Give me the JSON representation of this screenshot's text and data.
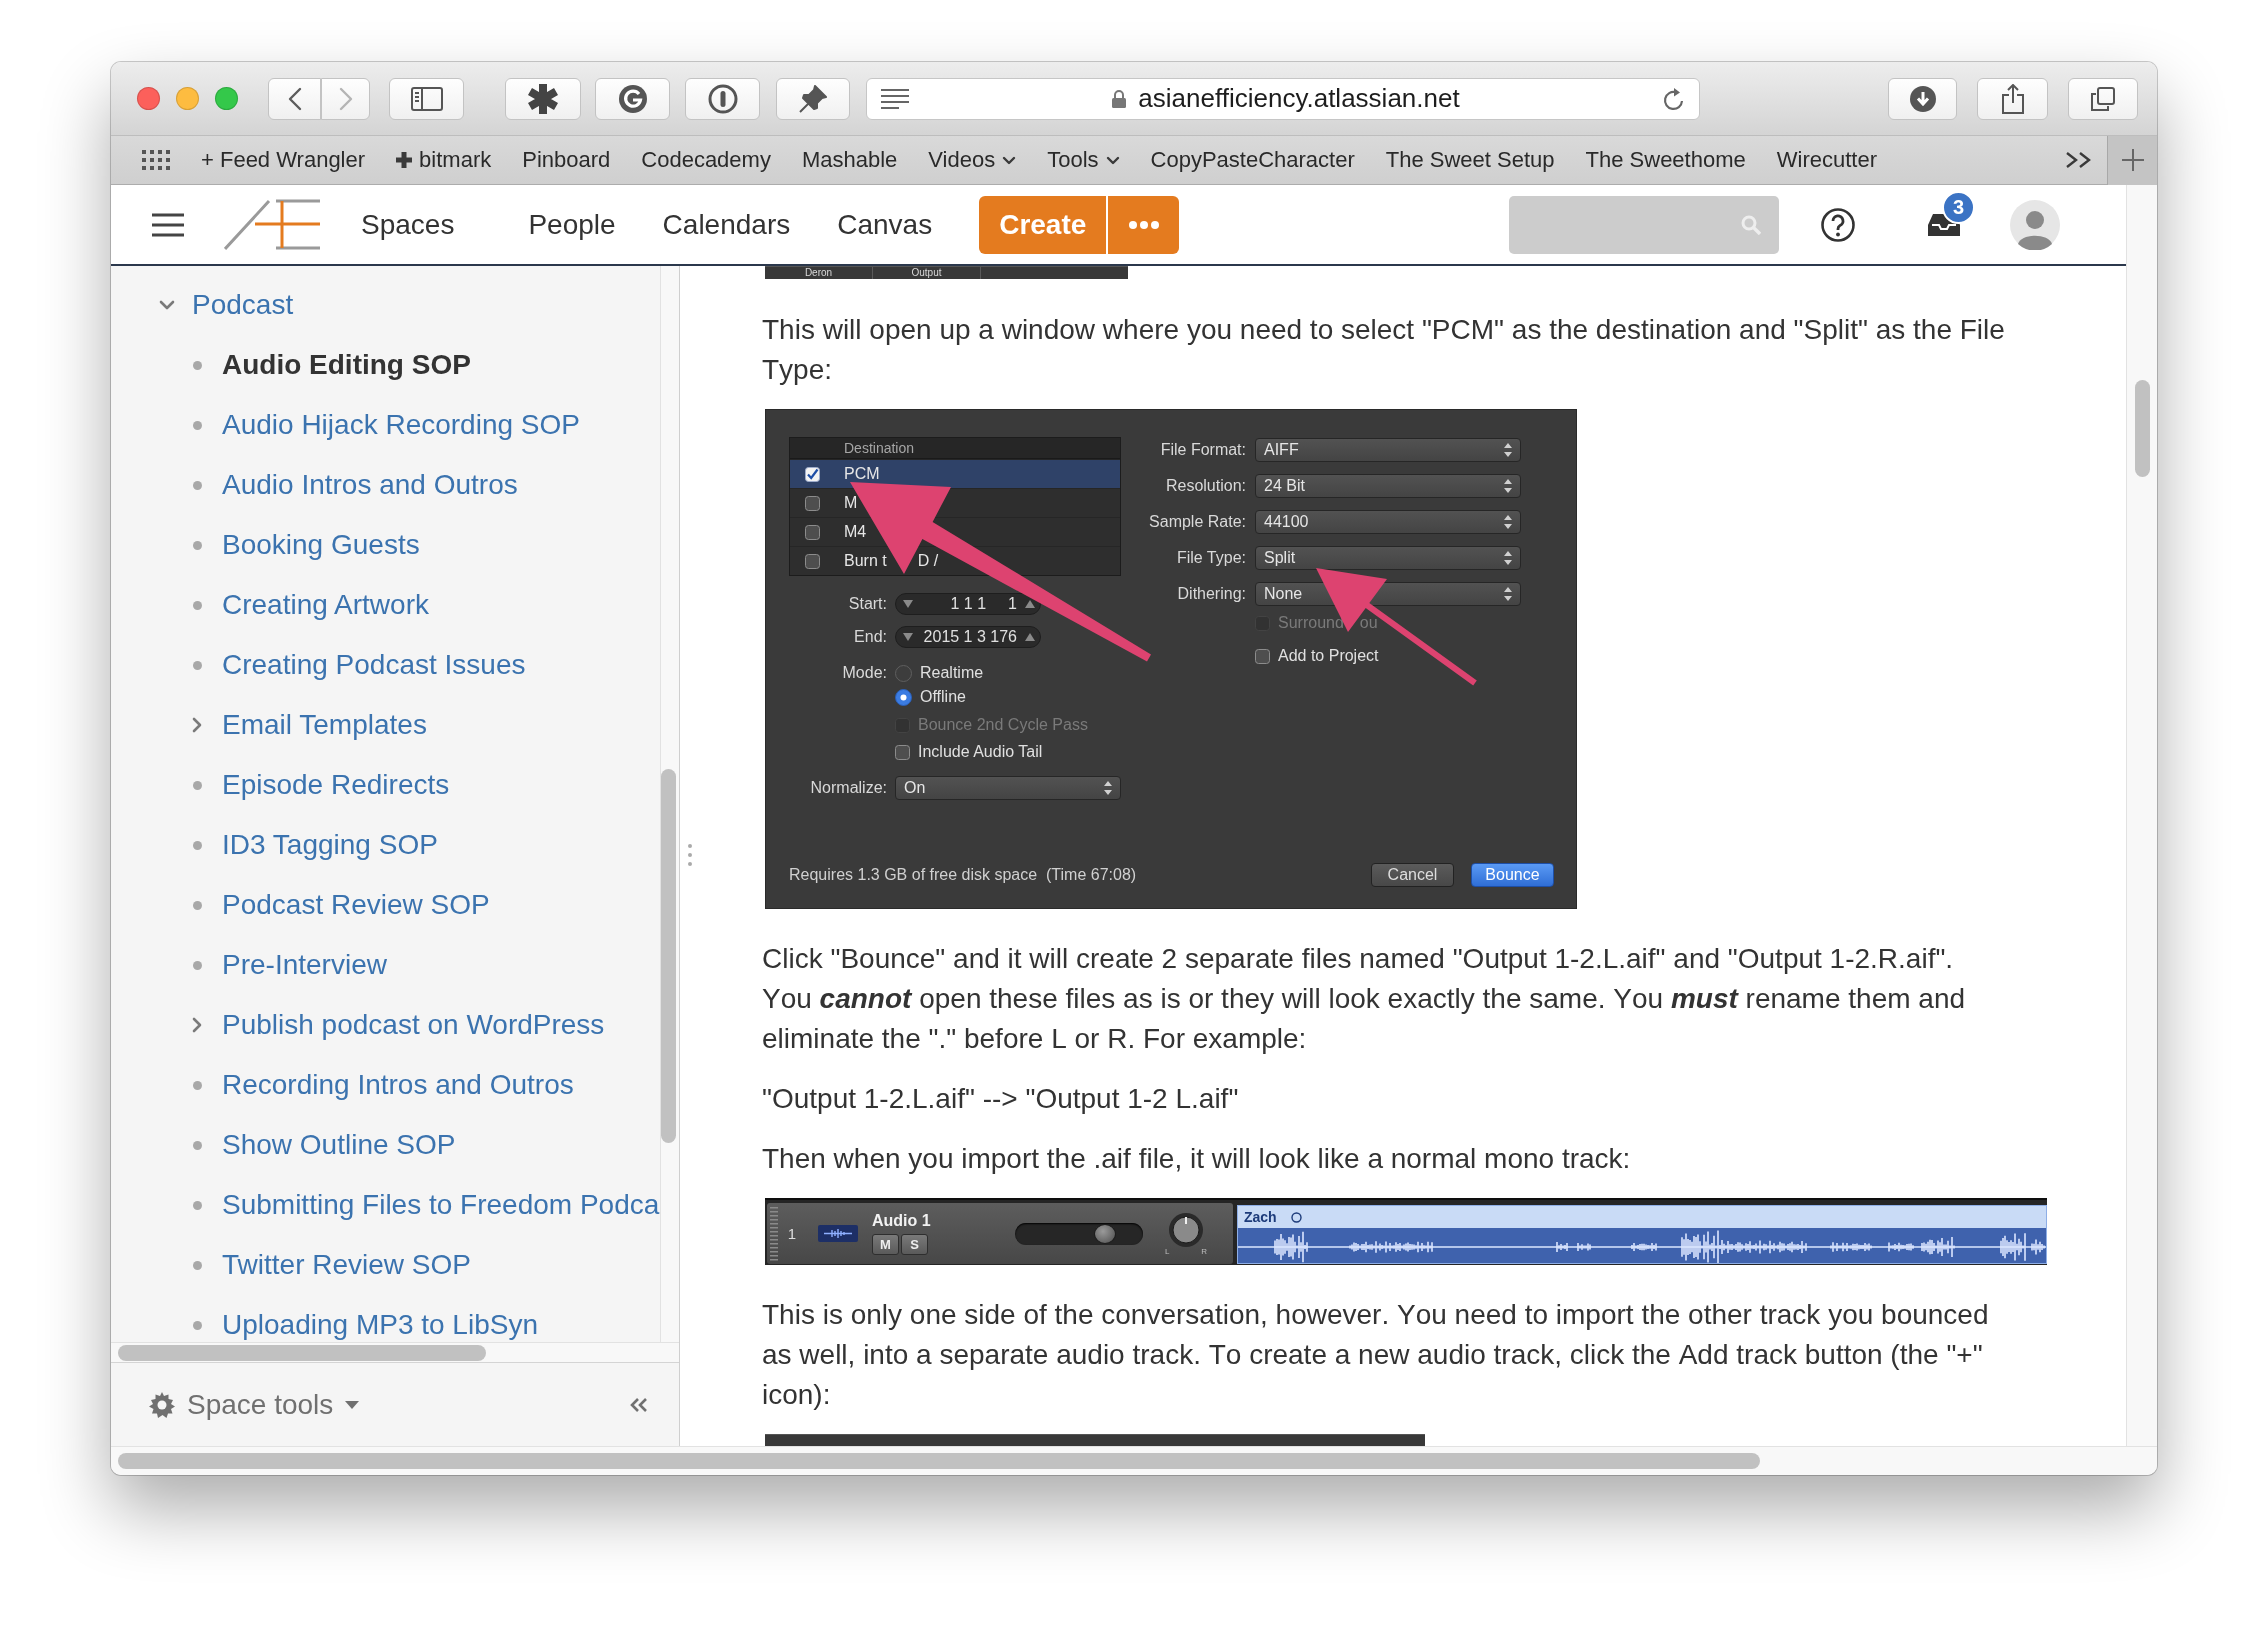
{
  "browser": {
    "history_buttons": [
      {
        "kind": "back",
        "disabled": false
      },
      {
        "kind": "forward",
        "disabled": true
      }
    ],
    "address": "asianefficiency.atlassian.net",
    "bookmarks": [
      {
        "label": "+ Feed Wrangler",
        "kind": "link"
      },
      {
        "label": "bitmark",
        "kind": "plus_link"
      },
      {
        "label": "Pinboard",
        "kind": "link"
      },
      {
        "label": "Codecademy",
        "kind": "link"
      },
      {
        "label": "Mashable",
        "kind": "link"
      },
      {
        "label": "Videos",
        "kind": "menu"
      },
      {
        "label": "Tools",
        "kind": "menu"
      },
      {
        "label": "CopyPasteCharacter",
        "kind": "link"
      },
      {
        "label": "The Sweet Setup",
        "kind": "link"
      },
      {
        "label": "The Sweethome",
        "kind": "link"
      },
      {
        "label": "Wirecutter",
        "kind": "link"
      }
    ]
  },
  "header": {
    "nav": [
      "Spaces",
      "People",
      "Calendars",
      "Canvas"
    ],
    "create_label": "Create",
    "notification_count": "3"
  },
  "sidebar": {
    "tree": [
      {
        "label": "Podcast",
        "kind": "folder",
        "expanded": true,
        "selected": false,
        "children": [
          {
            "label": "Audio Editing SOP",
            "kind": "page",
            "selected": true
          },
          {
            "label": "Audio Hijack Recording SOP",
            "kind": "page",
            "selected": false
          },
          {
            "label": "Audio Intros and Outros",
            "kind": "page",
            "selected": false
          },
          {
            "label": "Booking Guests",
            "kind": "page",
            "selected": false
          },
          {
            "label": "Creating Artwork",
            "kind": "page",
            "selected": false
          },
          {
            "label": "Creating Podcast Issues",
            "kind": "page",
            "selected": false
          },
          {
            "label": "Email Templates",
            "kind": "folder",
            "expanded": false,
            "selected": false
          },
          {
            "label": "Episode Redirects",
            "kind": "page",
            "selected": false
          },
          {
            "label": "ID3 Tagging SOP",
            "kind": "page",
            "selected": false
          },
          {
            "label": "Podcast Review SOP",
            "kind": "page",
            "selected": false
          },
          {
            "label": "Pre-Interview",
            "kind": "page",
            "selected": false
          },
          {
            "label": "Publish podcast on WordPress",
            "kind": "folder",
            "expanded": false,
            "selected": false
          },
          {
            "label": "Recording Intros and Outros",
            "kind": "page",
            "selected": false
          },
          {
            "label": "Show Outline SOP",
            "kind": "page",
            "selected": false
          },
          {
            "label": "Submitting Files to Freedom Podca",
            "kind": "page",
            "selected": false
          },
          {
            "label": "Twitter Review SOP",
            "kind": "page",
            "selected": false
          },
          {
            "label": "Uploading MP3 to LibSyn",
            "kind": "page",
            "selected": false
          }
        ]
      }
    ],
    "footer_label": "Space tools"
  },
  "content": {
    "blocks": [
      {
        "kind": "image_strip",
        "labels": [
          "Deron",
          "Output"
        ]
      },
      {
        "kind": "paragraph",
        "text": "This will open up a window where you need to select \"PCM\" as the destination and \"Split\" as the File Type:"
      },
      {
        "kind": "bounce_dialog",
        "destination": {
          "header": "Destination",
          "rows": [
            {
              "label": "PCM",
              "checked": true,
              "selected": true
            },
            {
              "label": "M",
              "checked": false,
              "selected": false
            },
            {
              "label": "M4",
              "checked": false,
              "selected": false
            },
            {
              "label": "Burn t",
              "label_2": "D /",
              "checked": false,
              "selected": false
            }
          ]
        },
        "positions": [
          {
            "label": "Start:",
            "values": [
              "1 1 1",
              "1"
            ]
          },
          {
            "label": "End:",
            "values": [
              "2015 1 3 176"
            ]
          }
        ],
        "mode": {
          "label": "Mode:",
          "options": [
            {
              "label": "Realtime",
              "selected": false
            },
            {
              "label": "Offline",
              "selected": true
            }
          ]
        },
        "options": [
          {
            "label": "Bounce 2nd Cycle Pass",
            "checked": false,
            "disabled": true
          },
          {
            "label": "Include Audio Tail",
            "checked": false,
            "disabled": false
          }
        ],
        "normalize": {
          "label": "Normalize:",
          "value": "On"
        },
        "settings": [
          {
            "label": "File Format:",
            "value": "AIFF"
          },
          {
            "label": "Resolution:",
            "value": "24 Bit"
          },
          {
            "label": "Sample Rate:",
            "value": "44100"
          },
          {
            "label": "File Type:",
            "value": "Split"
          },
          {
            "label": "Dithering:",
            "value": "None"
          }
        ],
        "checks": [
          {
            "label": "Surround",
            "label_2": "ou",
            "checked": false,
            "disabled": true
          },
          {
            "label": "Add to Project",
            "checked": false,
            "disabled": false
          }
        ],
        "note": "Requires 1.3 GB of free disk space  (Time 67:08)",
        "buttons": [
          {
            "label": "Cancel",
            "default": false
          },
          {
            "label": "Bounce",
            "default": true
          }
        ]
      },
      {
        "kind": "paragraph",
        "text": "Click \"Bounce\" and it will create 2 separate files named \"Output 1-2.L.aif\" and \"Output 1-2.R.aif\". You **cannot** open these files as is or they will look exactly the same. You **must** rename them and eliminate the \".\" before L or R. For example:"
      },
      {
        "kind": "paragraph",
        "text": "\"Output 1-2.L.aif\" --> \"Output 1-2 L.aif\""
      },
      {
        "kind": "paragraph",
        "text": "Then when you import the .aif file, it will look like a normal mono track:"
      },
      {
        "kind": "track_image",
        "number": "1",
        "name": "Audio 1",
        "buttons": [
          "M",
          "S"
        ],
        "level": 0.7,
        "pan_labels": [
          "L",
          "R"
        ],
        "region": "Zach"
      },
      {
        "kind": "paragraph",
        "text": "This is only one side of the conversation, however. You need to import the other track you bounced as well, into a separate audio track. To create a new audio track, click the Add track button (the \"+\" icon):"
      },
      {
        "kind": "image_strip"
      }
    ]
  }
}
